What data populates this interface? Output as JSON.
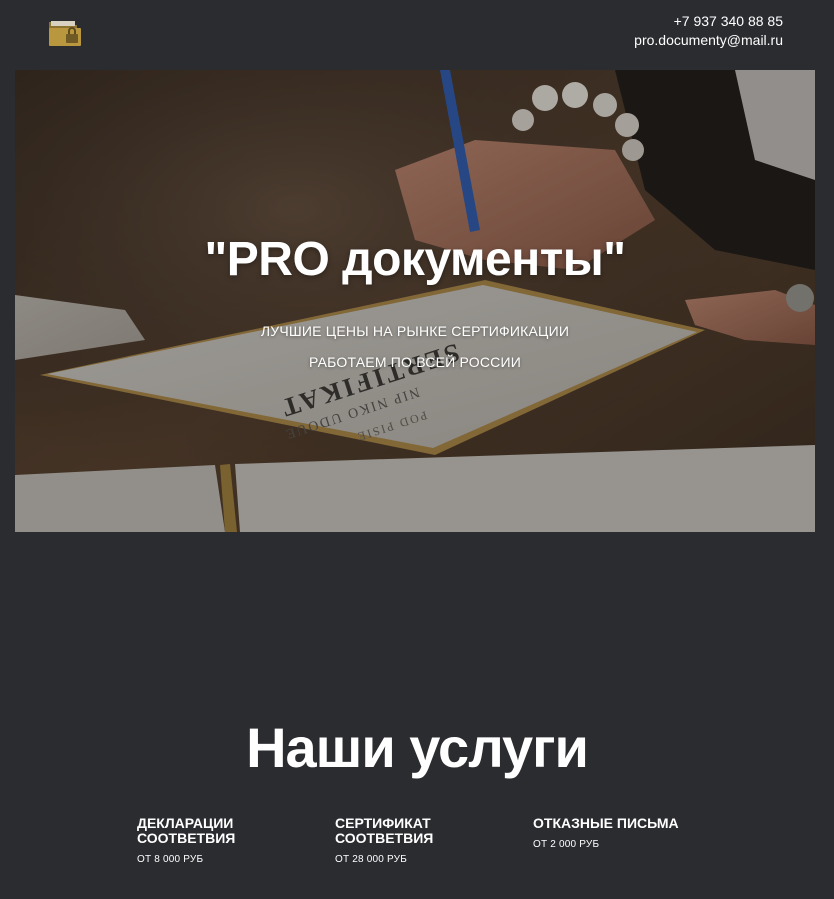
{
  "header": {
    "logo_icon": "folder-lock-icon",
    "phone": "+7 937 340 88 85",
    "email": "pro.documenty@mail.ru"
  },
  "hero": {
    "title": "\"PRO документы\"",
    "line1": "ЛУЧШИЕ ЦЕНЫ НА РЫНКЕ СЕРТИФИКАЦИИ",
    "line2": "РАБОТАЕМ ПО ВСЕЙ РОССИИ",
    "photo_certificate_text": "SERTIFIKAT",
    "photo_certificate_subtext": "NIP NIKO UDOUE",
    "photo_certificate_subtext2": "POD PISIE"
  },
  "services": {
    "title": "Наши услуги",
    "items": [
      {
        "name_line1": "ДЕКЛАРАЦИИ",
        "name_line2": "СООТВЕТВИЯ",
        "price": "ОТ 8 000 РУБ"
      },
      {
        "name_line1": "СЕРТИФИКАТ",
        "name_line2": "СООТВЕТВИЯ",
        "price": "ОТ 28 000 РУБ"
      },
      {
        "name_line1": "ОТКАЗНЫЕ ПИСЬМА",
        "name_line2": "",
        "price": "ОТ 2 000 РУБ"
      }
    ]
  },
  "colors": {
    "background": "#2b2c30",
    "text": "#ffffff",
    "logo_gold": "#b8973e"
  }
}
